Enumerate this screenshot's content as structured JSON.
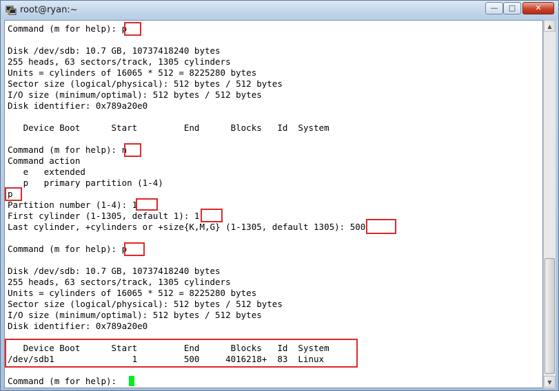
{
  "window": {
    "title": "root@ryan:~",
    "controls": {
      "minimize": "—",
      "maximize": "□",
      "close": "✕"
    }
  },
  "terminal": {
    "lines": [
      "Command (m for help): p",
      "",
      "Disk /dev/sdb: 10.7 GB, 10737418240 bytes",
      "255 heads, 63 sectors/track, 1305 cylinders",
      "Units = cylinders of 16065 * 512 = 8225280 bytes",
      "Sector size (logical/physical): 512 bytes / 512 bytes",
      "I/O size (minimum/optimal): 512 bytes / 512 bytes",
      "Disk identifier: 0x789a20e0",
      "",
      "   Device Boot      Start         End      Blocks   Id  System",
      "",
      "Command (m for help): n",
      "Command action",
      "   e   extended",
      "   p   primary partition (1-4)",
      "p",
      "Partition number (1-4): 1",
      "First cylinder (1-1305, default 1): 1",
      "Last cylinder, +cylinders or +size{K,M,G} (1-1305, default 1305): 500",
      "",
      "Command (m for help): p",
      "",
      "Disk /dev/sdb: 10.7 GB, 10737418240 bytes",
      "255 heads, 63 sectors/track, 1305 cylinders",
      "Units = cylinders of 16065 * 512 = 8225280 bytes",
      "Sector size (logical/physical): 512 bytes / 512 bytes",
      "I/O size (minimum/optimal): 512 bytes / 512 bytes",
      "Disk identifier: 0x789a20e0",
      "",
      "   Device Boot      Start         End      Blocks   Id  System",
      "/dev/sdb1               1         500     4016218+  83  Linux",
      "",
      "Command (m for help): "
    ],
    "cursor_color": "#00ee22",
    "highlight_color": "#e02727"
  },
  "scrollbar": {
    "up": "▲",
    "down": "▼"
  }
}
